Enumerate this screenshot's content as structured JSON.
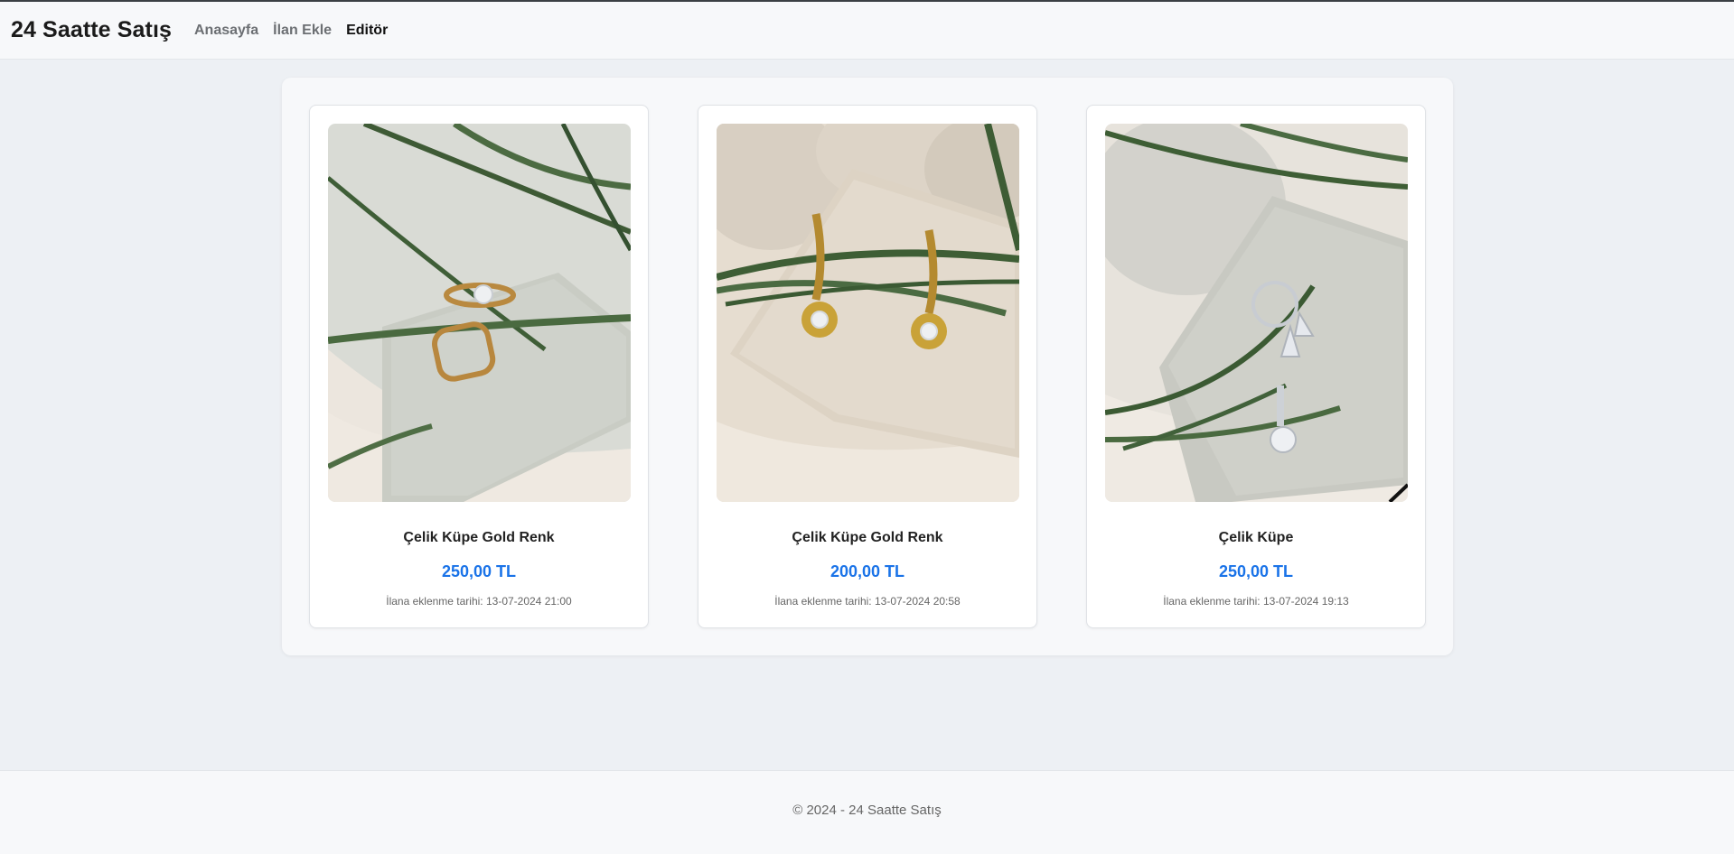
{
  "brand": "24 Saatte Satış",
  "nav": {
    "items": [
      {
        "label": "Anasayfa"
      },
      {
        "label": "İlan Ekle"
      },
      {
        "label": "Editör"
      }
    ]
  },
  "listings": [
    {
      "title": "Çelik Küpe Gold Renk",
      "price": "250,00 TL",
      "date": "İlana eklenme tarihi: 13-07-2024 21:00"
    },
    {
      "title": "Çelik Küpe Gold Renk",
      "price": "200,00 TL",
      "date": "İlana eklenme tarihi: 13-07-2024 20:58"
    },
    {
      "title": "Çelik Küpe",
      "price": "250,00 TL",
      "date": "İlana eklenme tarihi: 13-07-2024 19:13"
    }
  ],
  "footer": {
    "text": "© 2024 - 24 Saatte Satış"
  },
  "colors": {
    "price": "#1a73e8",
    "background": "#edf0f4",
    "panel": "#f7f8fa"
  }
}
